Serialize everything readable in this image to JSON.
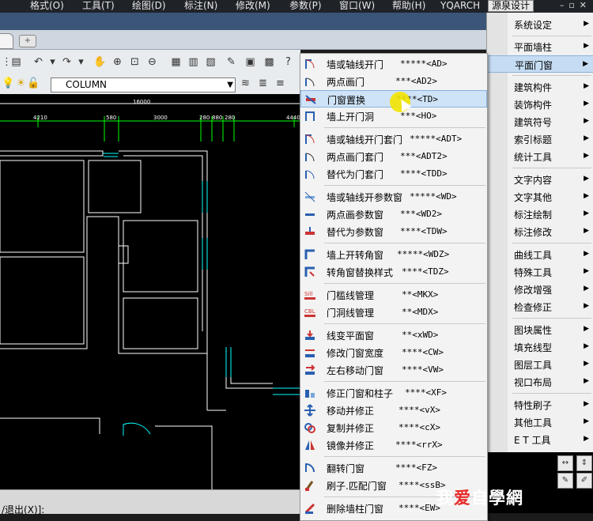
{
  "menubar": {
    "items": [
      "格式(O)",
      "工具(T)",
      "绘图(D)",
      "标注(N)",
      "修改(M)",
      "参数(P)",
      "窗口(W)",
      "帮助(H)",
      "YQARCH",
      "源泉设计"
    ]
  },
  "toolbar": {
    "layer_value": "COLUMN"
  },
  "drawing": {
    "dims": [
      "16000",
      "4210",
      "580",
      "3000",
      "280",
      "880",
      "280",
      "4440"
    ]
  },
  "command_line": "/退出(X)]:",
  "submenu": {
    "items": [
      {
        "label": "墙或轴线开门",
        "key": "*****<AD>",
        "icon": "door-axis-icon"
      },
      {
        "label": "两点画门",
        "key": "***<AD2>",
        "icon": "door-two-point-icon"
      },
      {
        "label": "门窗置换",
        "key": "****<TD>",
        "icon": "door-replace-icon"
      },
      {
        "label": "墙上开门洞",
        "key": "***<HO>",
        "icon": "door-hole-icon"
      },
      {
        "label": "墙或轴线开门套门",
        "key": "*****<ADT>",
        "icon": "door-frame-axis-icon"
      },
      {
        "label": "两点画门套门",
        "key": "***<ADT2>",
        "icon": "door-frame-two-point-icon"
      },
      {
        "label": "替代为门套门",
        "key": "****<TDD>",
        "icon": "door-frame-replace-icon"
      },
      {
        "label": "墙或轴线开参数窗",
        "key": "*****<WD>",
        "icon": "window-axis-icon"
      },
      {
        "label": "两点画参数窗",
        "key": "***<WD2>",
        "icon": "window-two-point-icon"
      },
      {
        "label": "替代为参数窗",
        "key": "****<TDW>",
        "icon": "window-replace-icon"
      },
      {
        "label": "墙上开转角窗",
        "key": "*****<WDZ>",
        "icon": "corner-window-icon"
      },
      {
        "label": "转角窗替换样式",
        "key": "****<TDZ>",
        "icon": "corner-window-style-icon"
      },
      {
        "label": "门槛线管理",
        "key": "**<MKX>",
        "icon": "sill-line-icon"
      },
      {
        "label": "门洞线管理",
        "key": "**<MDX>",
        "icon": "opening-line-icon"
      },
      {
        "label": "线变平面窗",
        "key": "**<xWD>",
        "icon": "line-to-window-icon"
      },
      {
        "label": "修改门窗宽度",
        "key": "****<CW>",
        "icon": "door-width-icon"
      },
      {
        "label": "左右移动门窗",
        "key": "****<VW>",
        "icon": "door-move-icon"
      },
      {
        "label": "修正门窗和柱子",
        "key": "****<XF>",
        "icon": "door-fix-icon"
      },
      {
        "label": "移动并修正",
        "key": "****<vX>",
        "icon": "move-fix-icon"
      },
      {
        "label": "复制并修正",
        "key": "****<cX>",
        "icon": "copy-fix-icon"
      },
      {
        "label": "镜像并修正",
        "key": "****<rrX>",
        "icon": "mirror-fix-icon"
      },
      {
        "label": "翻转门窗",
        "key": "****<FZ>",
        "icon": "flip-door-icon"
      },
      {
        "label": "刷子.匹配门窗",
        "key": "****<ssB>",
        "icon": "brush-match-icon"
      },
      {
        "label": "删除墙柱门窗",
        "key": "****<EW>",
        "icon": "delete-wall-icon"
      }
    ]
  },
  "rightmenu": {
    "items": [
      "系统设定",
      "平面墙柱",
      "平面门窗",
      "建筑构件",
      "装饰构件",
      "建筑符号",
      "索引标题",
      "统计工具",
      "文字内容",
      "文字其他",
      "标注绘制",
      "标注修改",
      "曲线工具",
      "特殊工具",
      "修改增强",
      "检查修正",
      "图块属性",
      "填充线型",
      "图层工具",
      "视口布局",
      "特性刷子",
      "其他工具",
      "E T 工具"
    ]
  },
  "watermark": {
    "text_before": "我",
    "text_heart": "爱",
    "text_after": "自學網"
  }
}
